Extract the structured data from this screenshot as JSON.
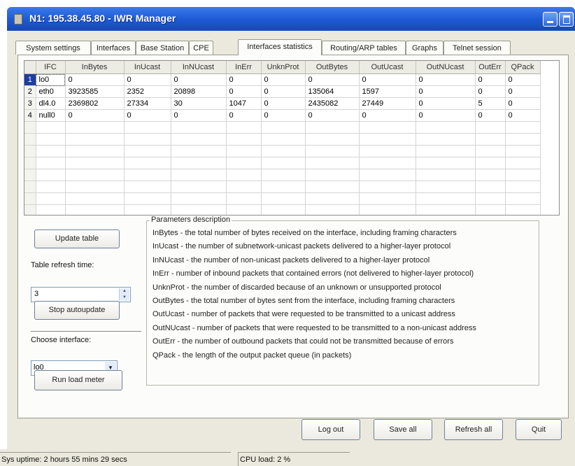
{
  "window": {
    "title": "N1: 195.38.45.80 - IWR Manager"
  },
  "tabs": [
    {
      "label": "System settings"
    },
    {
      "label": "Interfaces"
    },
    {
      "label": "Base Station"
    },
    {
      "label": "CPE"
    },
    {
      "label": "Interfaces statistics",
      "active": true
    },
    {
      "label": "Routing/ARP tables"
    },
    {
      "label": "Graphs"
    },
    {
      "label": "Telnet session"
    }
  ],
  "grid": {
    "columns": [
      "IFC",
      "InBytes",
      "InUcast",
      "InNUcast",
      "InErr",
      "UnknProt",
      "OutBytes",
      "OutUcast",
      "OutNUcast",
      "OutErr",
      "QPack"
    ],
    "rows": [
      {
        "num": "1",
        "cells": [
          "lo0",
          "0",
          "0",
          "0",
          "0",
          "0",
          "0",
          "0",
          "0",
          "0",
          "0"
        ]
      },
      {
        "num": "2",
        "cells": [
          "eth0",
          "3923585",
          "2352",
          "20898",
          "0",
          "0",
          "135064",
          "1597",
          "0",
          "0",
          "0"
        ]
      },
      {
        "num": "3",
        "cells": [
          "dl4.0",
          "2369802",
          "27334",
          "30",
          "1047",
          "0",
          "2435082",
          "27449",
          "0",
          "5",
          "0"
        ]
      },
      {
        "num": "4",
        "cells": [
          "null0",
          "0",
          "0",
          "0",
          "0",
          "0",
          "0",
          "0",
          "0",
          "0",
          "0"
        ]
      }
    ]
  },
  "controls": {
    "update_table": "Update table",
    "refresh_label": "Table refresh time:",
    "refresh_value": "3",
    "stop_autoupdate": "Stop autoupdate",
    "choose_interface_label": "Choose interface:",
    "interface_value": "lo0",
    "run_load_meter": "Run load meter"
  },
  "params": {
    "title": "Parameters description",
    "lines": [
      "InBytes - the total number of bytes received on the interface, including framing characters",
      "InUcast - the number of subnetwork-unicast packets delivered to a higher-layer protocol",
      "InNUcast - the number of non-unicast packets delivered to a higher-layer protocol",
      "InErr - number of inbound packets that contained errors (not delivered to higher-layer protocol)",
      "UnknProt - the number of discarded because of an unknown or unsupported protocol",
      "OutBytes - the total number of bytes sent from the interface, including framing characters",
      "OutUcast - number of packets that were requested to be transmitted to a unicast address",
      "OutNUcast - number of packets that were requested to be transmitted to a non-unicast address",
      "OutErr - the number of outbound packets that could not be transmitted because of errors",
      "QPack - the length of the output packet queue (in packets)"
    ]
  },
  "buttons": {
    "log_out": "Log out",
    "save_all": "Save all",
    "refresh_all": "Refresh all",
    "quit": "Quit"
  },
  "status": {
    "uptime": "Sys uptime: 2 hours 55 mins 29 secs",
    "cpu": "CPU load: 2 %"
  }
}
